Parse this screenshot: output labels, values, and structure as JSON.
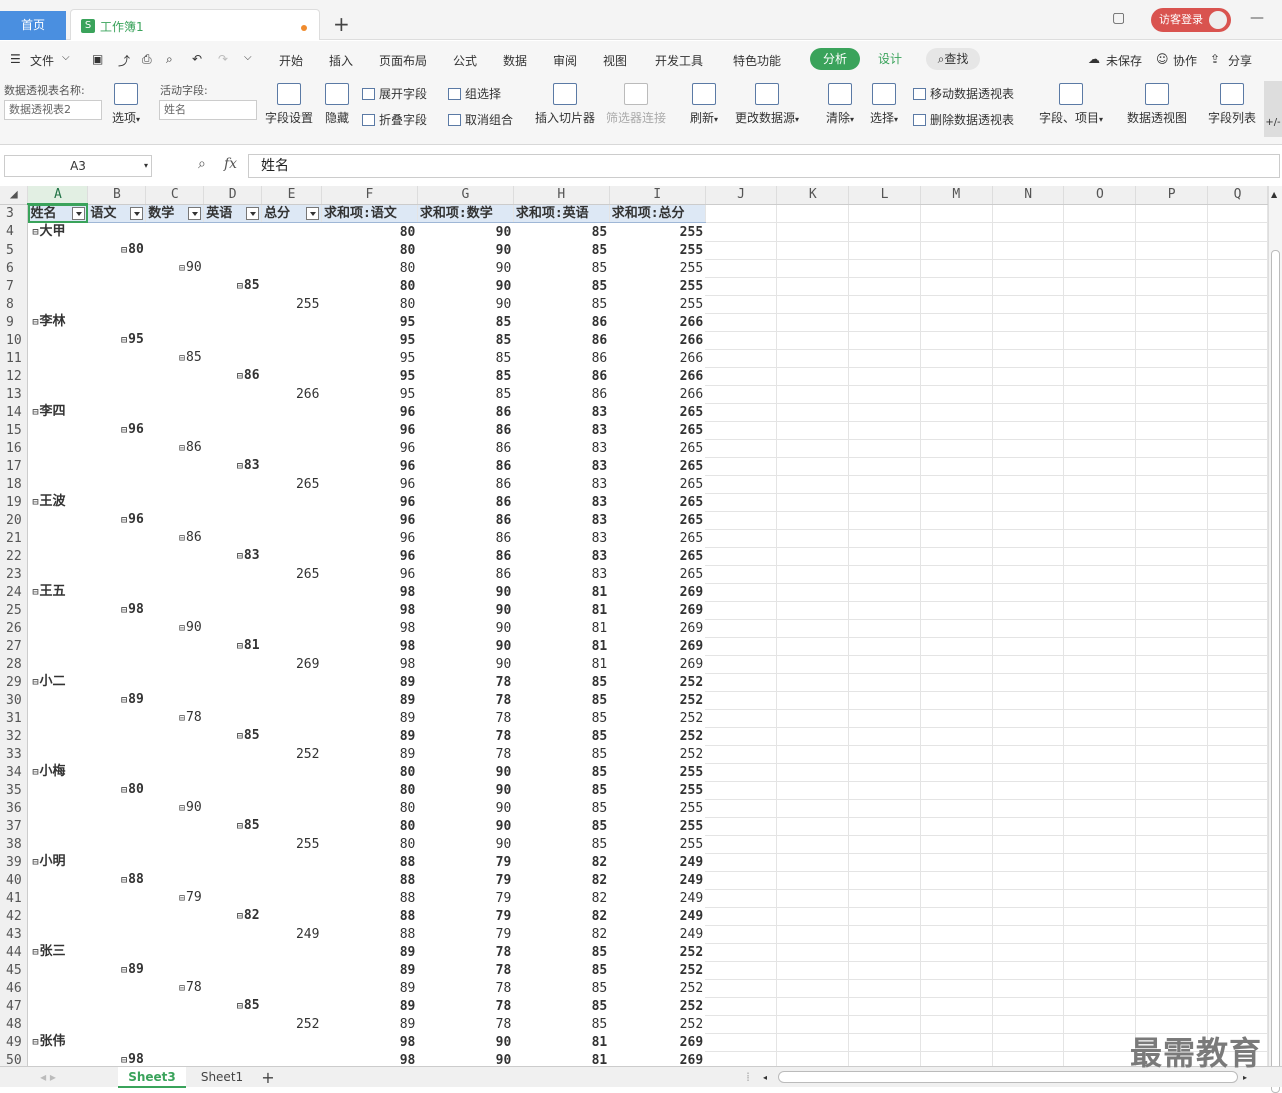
{
  "tabs": {
    "home": "首页",
    "doc": "工作簿1",
    "new": "+"
  },
  "account": {
    "login": "访客登录"
  },
  "menu": {
    "file": "文件",
    "items": [
      "开始",
      "插入",
      "页面布局",
      "公式",
      "数据",
      "审阅",
      "视图",
      "开发工具",
      "特色功能"
    ],
    "analyze": "分析",
    "design": "设计",
    "search": "查找",
    "unsaved": "未保存",
    "collab": "协作",
    "share": "分享"
  },
  "ribbon": {
    "pivot_name_label": "数据透视表名称:",
    "pivot_name_value": "数据透视表2",
    "options": "选项",
    "active_field_label": "活动字段:",
    "active_field_value": "姓名",
    "field_settings": "字段设置",
    "hide": "隐藏",
    "expand_field": "展开字段",
    "collapse_field": "折叠字段",
    "group_select": "组选择",
    "ungroup": "取消组合",
    "insert_slicer": "插入切片器",
    "filter_connections": "筛选器连接",
    "refresh": "刷新",
    "change_source": "更改数据源",
    "clear": "清除",
    "select": "选择",
    "move_pivot": "移动数据透视表",
    "delete_pivot": "删除数据透视表",
    "fields_items": "字段、项目",
    "pivot_chart": "数据透视图",
    "field_list": "字段列表",
    "plus_minus": "+/-"
  },
  "formula_bar": {
    "cell_ref": "A3",
    "fx": "fx",
    "value": "姓名"
  },
  "columns": [
    "A",
    "B",
    "C",
    "D",
    "E",
    "F",
    "G",
    "H",
    "I",
    "J",
    "K",
    "L",
    "M",
    "N",
    "O",
    "P",
    "Q"
  ],
  "header_row": {
    "row": "3",
    "cells": [
      "姓名",
      "语文",
      "数学",
      "英语",
      "总分",
      "求和项:语文",
      "求和项:数学",
      "求和项:英语",
      "求和项:总分"
    ]
  },
  "rows": [
    {
      "r": "4",
      "lvl": 0,
      "label": "大甲",
      "v": [
        "80",
        "90",
        "85",
        "255"
      ]
    },
    {
      "r": "5",
      "lvl": 1,
      "label": "80",
      "v": [
        "80",
        "90",
        "85",
        "255"
      ]
    },
    {
      "r": "6",
      "lvl": 2,
      "label": "90",
      "v": [
        "80",
        "90",
        "85",
        "255"
      ]
    },
    {
      "r": "7",
      "lvl": 3,
      "label": "85",
      "v": [
        "80",
        "90",
        "85",
        "255"
      ]
    },
    {
      "r": "8",
      "lvl": 4,
      "label": "255",
      "v": [
        "80",
        "90",
        "85",
        "255"
      ]
    },
    {
      "r": "9",
      "lvl": 0,
      "label": "李林",
      "v": [
        "95",
        "85",
        "86",
        "266"
      ]
    },
    {
      "r": "10",
      "lvl": 1,
      "label": "95",
      "v": [
        "95",
        "85",
        "86",
        "266"
      ]
    },
    {
      "r": "11",
      "lvl": 2,
      "label": "85",
      "v": [
        "95",
        "85",
        "86",
        "266"
      ]
    },
    {
      "r": "12",
      "lvl": 3,
      "label": "86",
      "v": [
        "95",
        "85",
        "86",
        "266"
      ]
    },
    {
      "r": "13",
      "lvl": 4,
      "label": "266",
      "v": [
        "95",
        "85",
        "86",
        "266"
      ]
    },
    {
      "r": "14",
      "lvl": 0,
      "label": "李四",
      "v": [
        "96",
        "86",
        "83",
        "265"
      ]
    },
    {
      "r": "15",
      "lvl": 1,
      "label": "96",
      "v": [
        "96",
        "86",
        "83",
        "265"
      ]
    },
    {
      "r": "16",
      "lvl": 2,
      "label": "86",
      "v": [
        "96",
        "86",
        "83",
        "265"
      ]
    },
    {
      "r": "17",
      "lvl": 3,
      "label": "83",
      "v": [
        "96",
        "86",
        "83",
        "265"
      ]
    },
    {
      "r": "18",
      "lvl": 4,
      "label": "265",
      "v": [
        "96",
        "86",
        "83",
        "265"
      ]
    },
    {
      "r": "19",
      "lvl": 0,
      "label": "王波",
      "v": [
        "96",
        "86",
        "83",
        "265"
      ]
    },
    {
      "r": "20",
      "lvl": 1,
      "label": "96",
      "v": [
        "96",
        "86",
        "83",
        "265"
      ]
    },
    {
      "r": "21",
      "lvl": 2,
      "label": "86",
      "v": [
        "96",
        "86",
        "83",
        "265"
      ]
    },
    {
      "r": "22",
      "lvl": 3,
      "label": "83",
      "v": [
        "96",
        "86",
        "83",
        "265"
      ]
    },
    {
      "r": "23",
      "lvl": 4,
      "label": "265",
      "v": [
        "96",
        "86",
        "83",
        "265"
      ]
    },
    {
      "r": "24",
      "lvl": 0,
      "label": "王五",
      "v": [
        "98",
        "90",
        "81",
        "269"
      ]
    },
    {
      "r": "25",
      "lvl": 1,
      "label": "98",
      "v": [
        "98",
        "90",
        "81",
        "269"
      ]
    },
    {
      "r": "26",
      "lvl": 2,
      "label": "90",
      "v": [
        "98",
        "90",
        "81",
        "269"
      ]
    },
    {
      "r": "27",
      "lvl": 3,
      "label": "81",
      "v": [
        "98",
        "90",
        "81",
        "269"
      ]
    },
    {
      "r": "28",
      "lvl": 4,
      "label": "269",
      "v": [
        "98",
        "90",
        "81",
        "269"
      ]
    },
    {
      "r": "29",
      "lvl": 0,
      "label": "小二",
      "v": [
        "89",
        "78",
        "85",
        "252"
      ]
    },
    {
      "r": "30",
      "lvl": 1,
      "label": "89",
      "v": [
        "89",
        "78",
        "85",
        "252"
      ]
    },
    {
      "r": "31",
      "lvl": 2,
      "label": "78",
      "v": [
        "89",
        "78",
        "85",
        "252"
      ]
    },
    {
      "r": "32",
      "lvl": 3,
      "label": "85",
      "v": [
        "89",
        "78",
        "85",
        "252"
      ]
    },
    {
      "r": "33",
      "lvl": 4,
      "label": "252",
      "v": [
        "89",
        "78",
        "85",
        "252"
      ]
    },
    {
      "r": "34",
      "lvl": 0,
      "label": "小梅",
      "v": [
        "80",
        "90",
        "85",
        "255"
      ]
    },
    {
      "r": "35",
      "lvl": 1,
      "label": "80",
      "v": [
        "80",
        "90",
        "85",
        "255"
      ]
    },
    {
      "r": "36",
      "lvl": 2,
      "label": "90",
      "v": [
        "80",
        "90",
        "85",
        "255"
      ]
    },
    {
      "r": "37",
      "lvl": 3,
      "label": "85",
      "v": [
        "80",
        "90",
        "85",
        "255"
      ]
    },
    {
      "r": "38",
      "lvl": 4,
      "label": "255",
      "v": [
        "80",
        "90",
        "85",
        "255"
      ]
    },
    {
      "r": "39",
      "lvl": 0,
      "label": "小明",
      "v": [
        "88",
        "79",
        "82",
        "249"
      ]
    },
    {
      "r": "40",
      "lvl": 1,
      "label": "88",
      "v": [
        "88",
        "79",
        "82",
        "249"
      ]
    },
    {
      "r": "41",
      "lvl": 2,
      "label": "79",
      "v": [
        "88",
        "79",
        "82",
        "249"
      ]
    },
    {
      "r": "42",
      "lvl": 3,
      "label": "82",
      "v": [
        "88",
        "79",
        "82",
        "249"
      ]
    },
    {
      "r": "43",
      "lvl": 4,
      "label": "249",
      "v": [
        "88",
        "79",
        "82",
        "249"
      ]
    },
    {
      "r": "44",
      "lvl": 0,
      "label": "张三",
      "v": [
        "89",
        "78",
        "85",
        "252"
      ]
    },
    {
      "r": "45",
      "lvl": 1,
      "label": "89",
      "v": [
        "89",
        "78",
        "85",
        "252"
      ]
    },
    {
      "r": "46",
      "lvl": 2,
      "label": "78",
      "v": [
        "89",
        "78",
        "85",
        "252"
      ]
    },
    {
      "r": "47",
      "lvl": 3,
      "label": "85",
      "v": [
        "89",
        "78",
        "85",
        "252"
      ]
    },
    {
      "r": "48",
      "lvl": 4,
      "label": "252",
      "v": [
        "89",
        "78",
        "85",
        "252"
      ]
    },
    {
      "r": "49",
      "lvl": 0,
      "label": "张伟",
      "v": [
        "98",
        "90",
        "81",
        "269"
      ]
    },
    {
      "r": "50",
      "lvl": 1,
      "label": "98",
      "v": [
        "98",
        "90",
        "81",
        "269"
      ]
    }
  ],
  "sheets": [
    "Sheet3",
    "Sheet1"
  ],
  "add_sheet": "+",
  "watermark": "最需教育",
  "colors": {
    "accent_green": "#3aa35b",
    "home_tab": "#4a8fe0",
    "login_red": "#d9534f"
  }
}
